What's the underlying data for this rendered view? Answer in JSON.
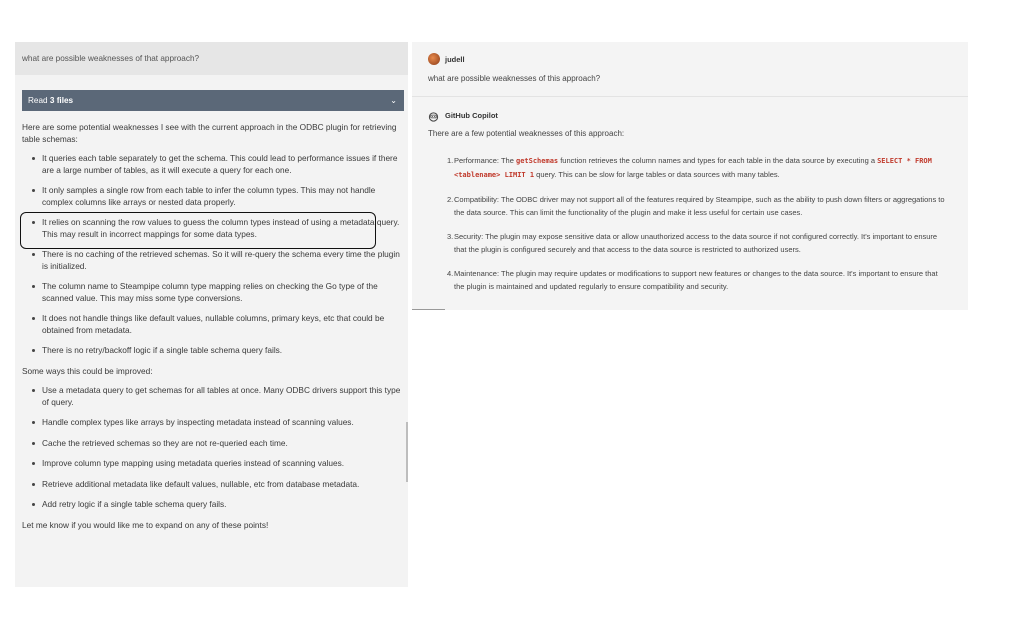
{
  "left": {
    "question": "what are possible weaknesses of that approach?",
    "read_prefix": "Read ",
    "read_bold": "3 files",
    "intro": "Here are some potential weaknesses I see with the current approach in the ODBC plugin for retrieving table schemas:",
    "weaknesses": [
      "It queries each table separately to get the schema. This could lead to performance issues if there are a large number of tables, as it will execute a query for each one.",
      "It only samples a single row from each table to infer the column types. This may not handle complex columns like arrays or nested data properly.",
      "It relies on scanning the row values to guess the column types instead of using a metadata query. This may result in incorrect mappings for some data types.",
      "There is no caching of the retrieved schemas. So it will re-query the schema every time the plugin is initialized.",
      "The column name to Steampipe column type mapping relies on checking the Go type of the scanned value. This may miss some type conversions.",
      "It does not handle things like default values, nullable columns, primary keys, etc that could be obtained from metadata.",
      "There is no retry/backoff logic if a single table schema query fails."
    ],
    "improve_heading": "Some ways this could be improved:",
    "improvements": [
      "Use a metadata query to get schemas for all tables at once. Many ODBC drivers support this type of query.",
      "Handle complex types like arrays by inspecting metadata instead of scanning values.",
      "Cache the retrieved schemas so they are not re-queried each time.",
      "Improve column type mapping using metadata queries instead of scanning values.",
      "Retrieve additional metadata like default values, nullable, etc from database metadata.",
      "Add retry logic if a single table schema query fails."
    ],
    "closing": "Let me know if you would like me to expand on any of these points!"
  },
  "right": {
    "user_name": "judell",
    "user_message": "what are possible weaknesses of this approach?",
    "copilot_name": "GitHub Copilot",
    "copilot_intro": "There are a few potential weaknesses of this approach:",
    "items": [
      {
        "num": "1.",
        "parts": [
          {
            "t": "Performance: The "
          },
          {
            "c": "getSchemas"
          },
          {
            "t": " function retrieves the column names and types for each table in the data source by executing a "
          },
          {
            "c": "SELECT * FROM <tablename> LIMIT 1"
          },
          {
            "t": " query. This can be slow for large tables or data sources with many tables."
          }
        ]
      },
      {
        "num": "2.",
        "parts": [
          {
            "t": "Compatibility: The ODBC driver may not support all of the features required by Steampipe, such as the ability to push down filters or aggregations to the data source. This can limit the functionality of the plugin and make it less useful for certain use cases."
          }
        ]
      },
      {
        "num": "3.",
        "parts": [
          {
            "t": "Security: The plugin may expose sensitive data or allow unauthorized access to the data source if not configured correctly. It's important to ensure that the plugin is configured securely and that access to the data source is restricted to authorized users."
          }
        ]
      },
      {
        "num": "4.",
        "parts": [
          {
            "t": "Maintenance: The plugin may require updates or modifications to support new features or changes to the data source. It's important to ensure that the plugin is maintained and updated regularly to ensure compatibility and security."
          }
        ]
      }
    ]
  },
  "colors": {
    "read_bar": "#5b6878",
    "code_red": "#c0392b",
    "left_panel": "#f3f3f3",
    "right_panel": "#f4f4f4"
  }
}
